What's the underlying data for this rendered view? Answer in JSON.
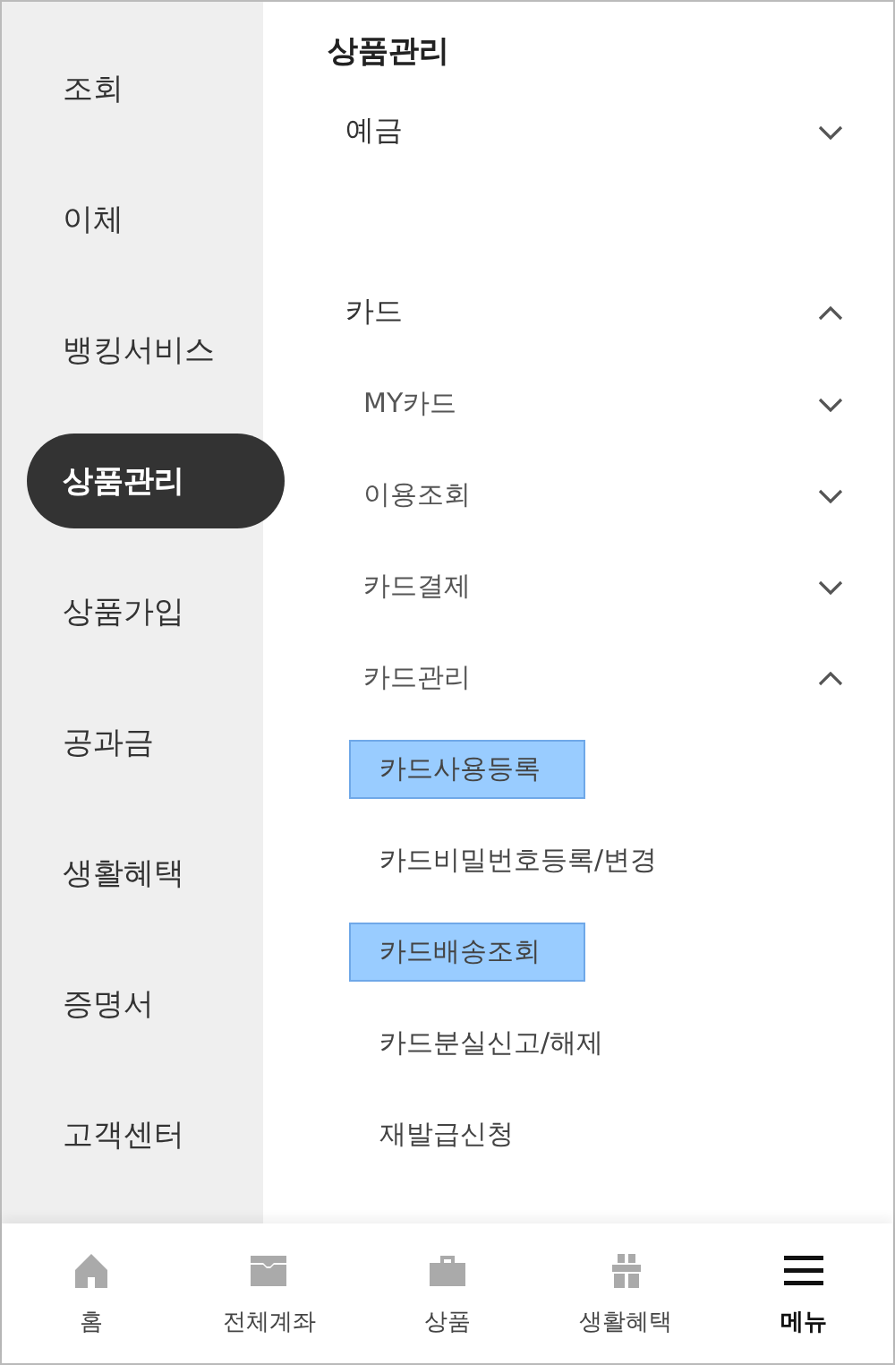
{
  "sidebar": {
    "items": [
      {
        "label": "조회",
        "selected": false
      },
      {
        "label": "이체",
        "selected": false
      },
      {
        "label": "뱅킹서비스",
        "selected": false
      },
      {
        "label": "상품관리",
        "selected": true
      },
      {
        "label": "상품가입",
        "selected": false
      },
      {
        "label": "공과금",
        "selected": false
      },
      {
        "label": "생활혜택",
        "selected": false
      },
      {
        "label": "증명서",
        "selected": false
      },
      {
        "label": "고객센터",
        "selected": false
      }
    ]
  },
  "content": {
    "title": "상품관리",
    "sections": [
      {
        "label": "예금",
        "expanded": false
      },
      {
        "label": "카드",
        "expanded": true,
        "children": [
          {
            "label": "MY카드",
            "expanded": false
          },
          {
            "label": "이용조회",
            "expanded": false
          },
          {
            "label": "카드결제",
            "expanded": false
          },
          {
            "label": "카드관리",
            "expanded": true,
            "children": [
              {
                "label": "카드사용등록",
                "highlighted": true
              },
              {
                "label": "카드비밀번호등록/변경",
                "highlighted": false
              },
              {
                "label": "카드배송조회",
                "highlighted": true
              },
              {
                "label": "카드분실신고/해제",
                "highlighted": false
              },
              {
                "label": "재발급신청",
                "highlighted": false
              }
            ]
          }
        ]
      }
    ]
  },
  "bottom_nav": [
    {
      "label": "홈",
      "selected": false
    },
    {
      "label": "전체계좌",
      "selected": false
    },
    {
      "label": "상품",
      "selected": false
    },
    {
      "label": "생활혜택",
      "selected": false
    },
    {
      "label": "메뉴",
      "selected": true
    }
  ]
}
